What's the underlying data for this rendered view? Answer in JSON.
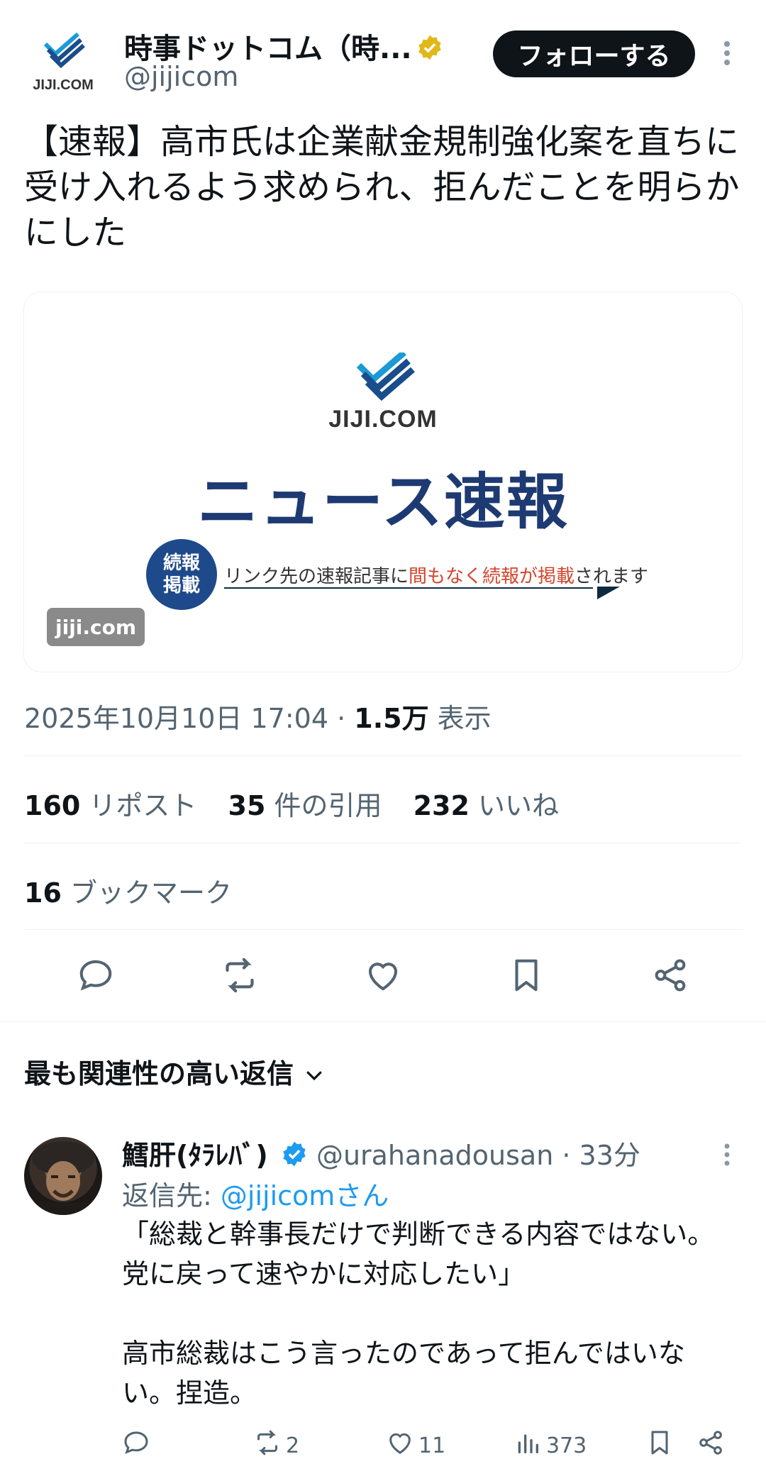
{
  "author": {
    "name": "時事ドットコム（時...",
    "handle": "@jijicom",
    "logo_text": "JIJI.COM"
  },
  "follow_label": "フォローする",
  "tweet": {
    "text": "【速報】高市氏は企業献金規制強化案を直ちに受け入れるよう求められ、拒んだことを明らかにした"
  },
  "media": {
    "logo_text": "JIJI.COM",
    "title": "ニュース速報",
    "badge_line1": "続報",
    "badge_line2": "掲載",
    "ticker_pre": "リンク先の速報記事に",
    "ticker_red": "間もなく続報が掲載",
    "ticker_post": "されます",
    "domain": "jiji.com"
  },
  "meta": {
    "datetime": "2025年10月10日 17:04",
    "sep": " · ",
    "views": "1.5万",
    "views_label": " 表示"
  },
  "stats": {
    "reposts": "160",
    "reposts_label": " リポスト",
    "quotes": "35",
    "quotes_label": " 件の引用",
    "likes": "232",
    "likes_label": " いいね",
    "bookmarks": "16",
    "bookmarks_label": " ブックマーク"
  },
  "replies_header": "最も関連性の高い返信",
  "reply": {
    "name": "鱈肝(ﾀﾗﾚﾊﾞ)",
    "handle": "@urahanadousan",
    "time": " · 33分",
    "reply_to_prefix": "返信先: ",
    "reply_to_link": "@jijicomさん",
    "body": "「総裁と幹事長だけで判断できる内容ではない。党に戻って速やかに対応したい」\n\n高市総裁はこう言ったのであって拒んではいない。捏造。",
    "retweets": "2",
    "likes": "11",
    "views": "373"
  },
  "colors": {
    "accent": "#1d9bf0",
    "muted": "#536471",
    "navy": "#1e3a72",
    "alert_red": "#d3452c"
  }
}
